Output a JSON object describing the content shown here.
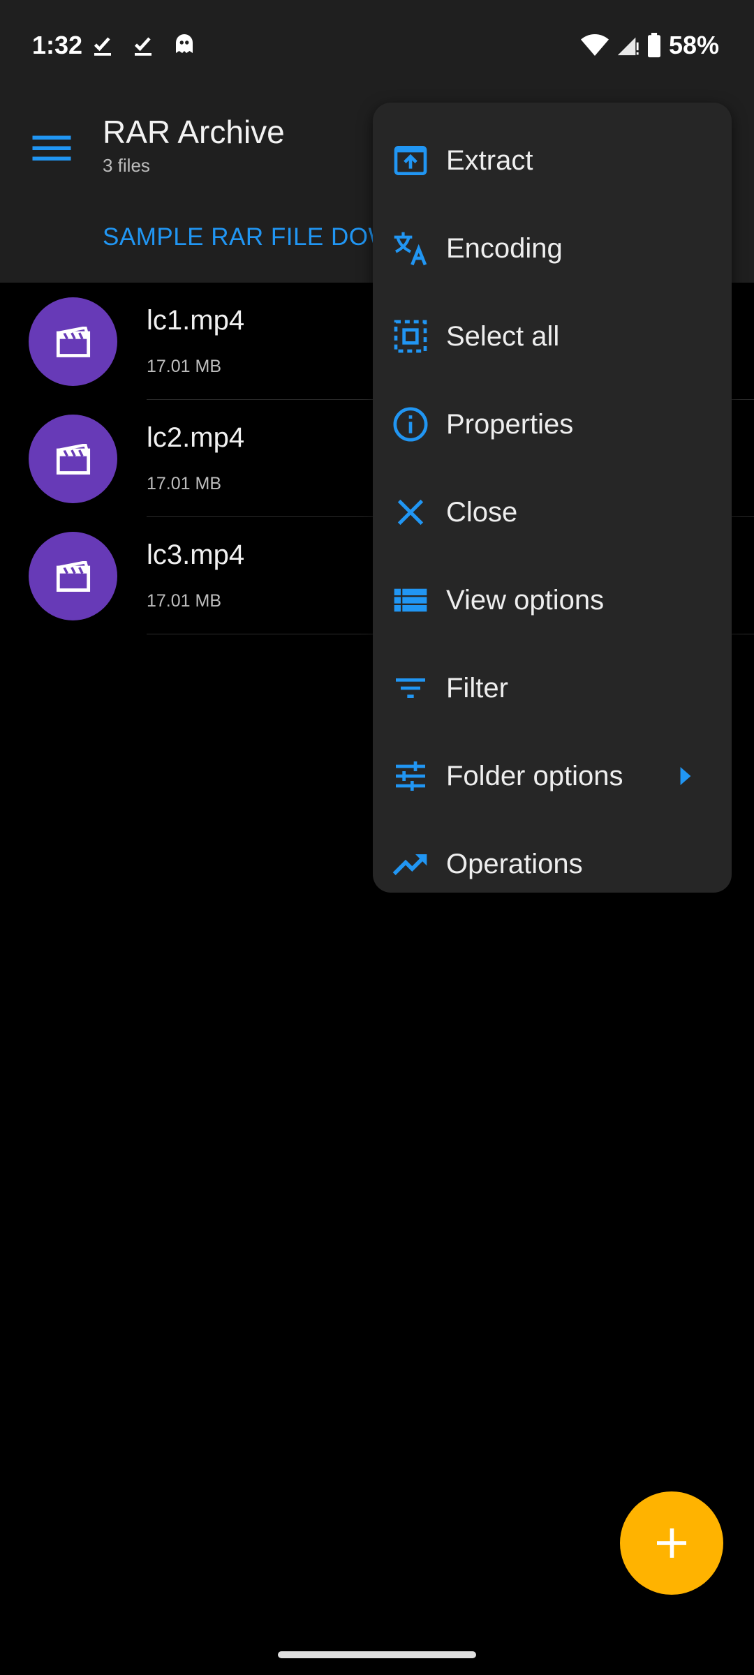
{
  "status_bar": {
    "time": "1:32",
    "battery": "58%",
    "icons": [
      "check-icon",
      "check-icon",
      "ghost-icon",
      "wifi-icon",
      "signal-icon",
      "battery-icon"
    ]
  },
  "app_bar": {
    "title": "RAR Archive",
    "subtitle": "3 files",
    "breadcrumb": "SAMPLE RAR FILE DOW"
  },
  "files": [
    {
      "name": "lc1.mp4",
      "size": "17.01 MB",
      "icon": "video-clapper-icon"
    },
    {
      "name": "lc2.mp4",
      "size": "17.01 MB",
      "icon": "video-clapper-icon"
    },
    {
      "name": "lc3.mp4",
      "size": "17.01 MB",
      "icon": "video-clapper-icon"
    }
  ],
  "menu": {
    "items": [
      {
        "label": "Extract",
        "icon": "extract-icon"
      },
      {
        "label": "Encoding",
        "icon": "translate-icon"
      },
      {
        "label": "Select all",
        "icon": "select-all-icon"
      },
      {
        "label": "Properties",
        "icon": "info-icon"
      },
      {
        "label": "Close",
        "icon": "close-icon"
      },
      {
        "label": "View options",
        "icon": "view-list-icon"
      },
      {
        "label": "Filter",
        "icon": "filter-icon"
      },
      {
        "label": "Folder options",
        "icon": "tune-icon",
        "has_submenu": true
      },
      {
        "label": "Operations",
        "icon": "trending-up-icon"
      }
    ]
  },
  "fab": {
    "icon": "plus-icon"
  },
  "colors": {
    "accent": "#2196f3",
    "surface": "#1f1f1f",
    "menu_bg": "#262626",
    "avatar": "#673ab7",
    "fab": "#ffb300"
  }
}
